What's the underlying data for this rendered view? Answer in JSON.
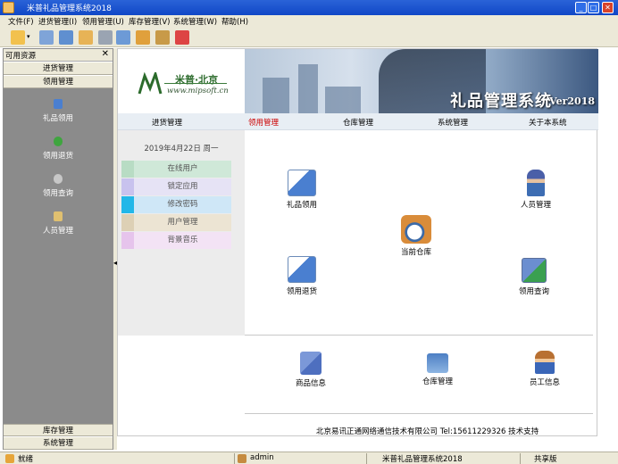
{
  "window": {
    "title": "米普礼品管理系统2018"
  },
  "menu": [
    "文件(F)",
    "进货管理(I)",
    "领用管理(U)",
    "库存管理(V)",
    "系统管理(W)",
    "帮助(H)"
  ],
  "toolbar_icons": [
    "open-folder-icon",
    "panel-icon",
    "book-icon",
    "home-icon",
    "printer-icon",
    "users-icon",
    "gift-icon",
    "user-lock-icon",
    "exit-icon"
  ],
  "left_panel": {
    "header": "可用资源",
    "close": "✕",
    "categories_top": [
      "进货管理",
      "领用管理"
    ],
    "items": [
      {
        "label": "礼品领用",
        "icon": "gift-doc-icon",
        "color": "#4a7fd0"
      },
      {
        "label": "领用退货",
        "icon": "return-icon",
        "color": "#3fa53f"
      },
      {
        "label": "领用查询",
        "icon": "search-icon",
        "color": "#c7c7c7"
      },
      {
        "label": "人员管理",
        "icon": "document-icon",
        "color": "#e0c070"
      }
    ],
    "categories_bottom": [
      "库存管理",
      "系统管理"
    ]
  },
  "banner": {
    "logo_name": "米普·北京",
    "logo_url": "www.mipsoft.cn",
    "title": "礼品管理系统",
    "version": "Ver2018"
  },
  "nav": {
    "items": [
      "进货管理",
      "领用管理",
      "仓库管理",
      "系统管理",
      "关于本系统"
    ],
    "active": "领用管理"
  },
  "sidebar": {
    "date": "2019年4月22日 周一",
    "links": [
      {
        "label": "在线用户",
        "color": "#cfe8d8",
        "swatch": "#b8dcc4"
      },
      {
        "label": "锁定应用",
        "color": "#e6e3f5",
        "swatch": "#c8c2ee"
      },
      {
        "label": "修改密码",
        "color": "#cfe7f7",
        "swatch": "#22b7e8"
      },
      {
        "label": "用户管理",
        "color": "#ece4d3",
        "swatch": "#ddd0b5"
      },
      {
        "label": "背景音乐",
        "color": "#f3e3f5",
        "swatch": "#e6c4ec"
      }
    ]
  },
  "functions": {
    "gift_use": "礼品领用",
    "staff_mgmt": "人员管理",
    "current_store": "当前仓库",
    "use_return": "领用退货",
    "use_query": "领用查询",
    "product_info": "商品信息",
    "store_mgmt": "仓库管理",
    "employee_info": "员工信息"
  },
  "footer": {
    "text": "北京易讯正通网络通信技术有限公司 Tel:15611229326  技术支持"
  },
  "status": {
    "ready": "就绪",
    "user": "admin",
    "app": "米普礼品管理系统2018",
    "edition": "共享版"
  }
}
